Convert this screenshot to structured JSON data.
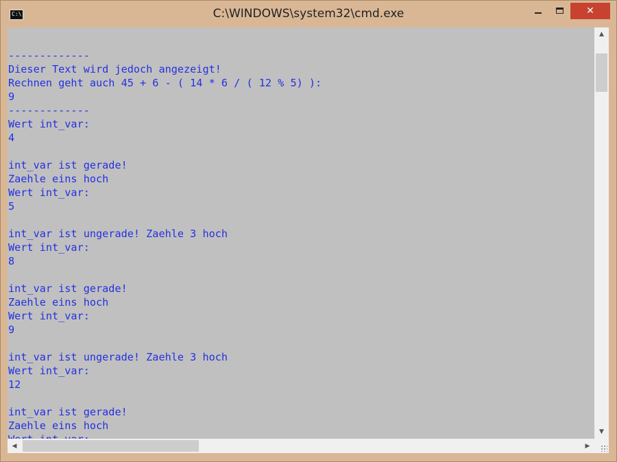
{
  "window": {
    "title": "C:\\WINDOWS\\system32\\cmd.exe",
    "icon": "cmd-icon",
    "icon_text": "C:\\",
    "controls": {
      "minimize": "minimize-icon",
      "maximize": "maximize-icon",
      "close": "close-icon",
      "close_glyph": "✕"
    }
  },
  "colors": {
    "console_bg": "#c0c0c0",
    "console_text": "#2430e0",
    "frame": "#d9b795",
    "close_button": "#c7432f"
  },
  "console": {
    "lines": [
      "",
      "-------------",
      "Dieser Text wird jedoch angezeigt!",
      "Rechnen geht auch 45 + 6 - ( 14 * 6 / ( 12 % 5) ):",
      "9",
      "-------------",
      "Wert int_var:",
      "4",
      "",
      "int_var ist gerade!",
      "Zaehle eins hoch",
      "Wert int_var:",
      "5",
      "",
      "int_var ist ungerade! Zaehle 3 hoch",
      "Wert int_var:",
      "8",
      "",
      "int_var ist gerade!",
      "Zaehle eins hoch",
      "Wert int_var:",
      "9",
      "",
      "int_var ist ungerade! Zaehle 3 hoch",
      "Wert int_var:",
      "12",
      "",
      "int_var ist gerade!",
      "Zaehle eins hoch",
      "Wert int_var:"
    ]
  },
  "scrollbars": {
    "up": "▲",
    "down": "▼",
    "left": "◀",
    "right": "▶"
  }
}
